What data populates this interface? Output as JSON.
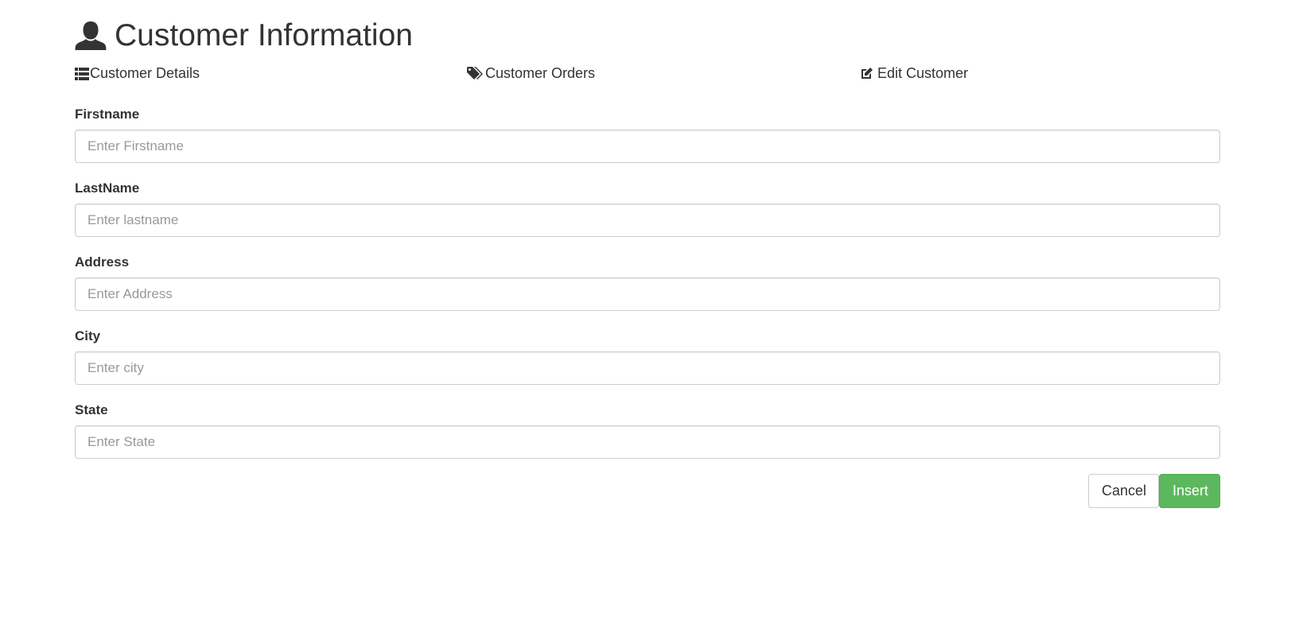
{
  "header": {
    "title": "Customer Information",
    "icon": "user-icon"
  },
  "nav": {
    "details_label": "Customer Details",
    "orders_label": "Customer Orders",
    "edit_label": "Edit Customer"
  },
  "form": {
    "firstname": {
      "label": "Firstname",
      "placeholder": "Enter Firstname",
      "value": ""
    },
    "lastname": {
      "label": "LastName",
      "placeholder": "Enter lastname",
      "value": ""
    },
    "address": {
      "label": "Address",
      "placeholder": "Enter Address",
      "value": ""
    },
    "city": {
      "label": "City",
      "placeholder": "Enter city",
      "value": ""
    },
    "state": {
      "label": "State",
      "placeholder": "Enter State",
      "value": ""
    }
  },
  "buttons": {
    "cancel_label": "Cancel",
    "insert_label": "Insert"
  },
  "colors": {
    "text": "#333333",
    "insert_button": "#5cb85c",
    "input_border": "#cccccc",
    "placeholder": "#999999"
  }
}
